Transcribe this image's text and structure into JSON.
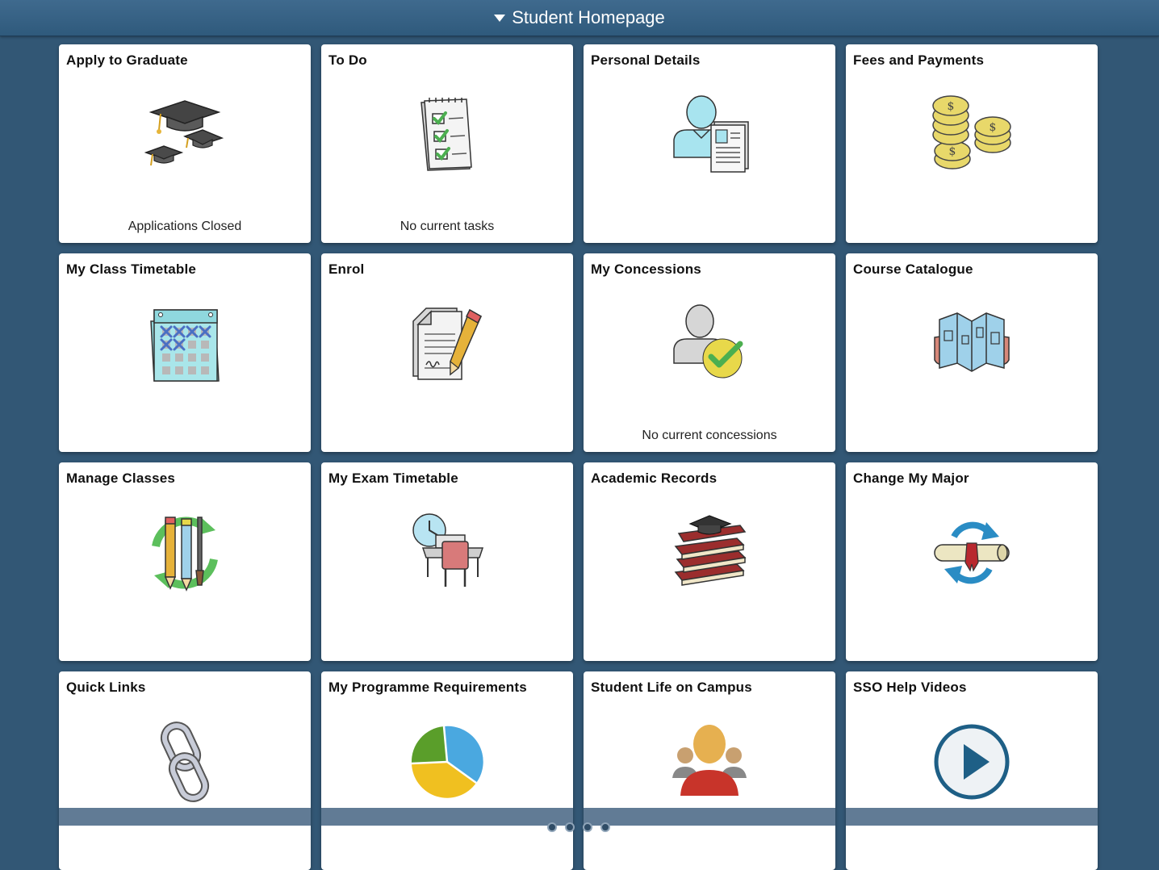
{
  "header": {
    "title": "Student Homepage"
  },
  "tiles": [
    {
      "title": "Apply to Graduate",
      "subtitle": "Applications Closed",
      "icon": "graduation-caps-icon"
    },
    {
      "title": "To Do",
      "subtitle": "No current tasks",
      "icon": "checklist-notepad-icon"
    },
    {
      "title": "Personal Details",
      "subtitle": "",
      "icon": "person-profile-document-icon"
    },
    {
      "title": "Fees and Payments",
      "subtitle": "",
      "icon": "coins-stack-icon"
    },
    {
      "title": "My Class Timetable",
      "subtitle": "",
      "icon": "calendar-icon"
    },
    {
      "title": "Enrol",
      "subtitle": "",
      "icon": "document-pencil-icon"
    },
    {
      "title": "My Concessions",
      "subtitle": "No current concessions",
      "icon": "person-checkmark-icon"
    },
    {
      "title": "Course Catalogue",
      "subtitle": "",
      "icon": "open-brochure-icon"
    },
    {
      "title": "Manage Classes",
      "subtitle": "",
      "icon": "pencils-recycle-icon"
    },
    {
      "title": "My Exam Timetable",
      "subtitle": "",
      "icon": "exam-desk-clock-icon"
    },
    {
      "title": "Academic Records",
      "subtitle": "",
      "icon": "books-mortarboard-icon"
    },
    {
      "title": "Change My Major",
      "subtitle": "",
      "icon": "diploma-refresh-icon"
    },
    {
      "title": "Quick Links",
      "subtitle": "",
      "icon": "chain-link-icon"
    },
    {
      "title": "My Programme Requirements",
      "subtitle": "",
      "icon": "pie-chart-icon"
    },
    {
      "title": "Student Life on Campus",
      "subtitle": "",
      "icon": "people-group-icon"
    },
    {
      "title": "SSO Help Videos",
      "subtitle": "",
      "icon": "play-button-icon"
    }
  ],
  "colors": {
    "background": "#325775",
    "header": "#3a6589",
    "tile": "#ffffff"
  },
  "pagination": {
    "page_count": 4
  }
}
